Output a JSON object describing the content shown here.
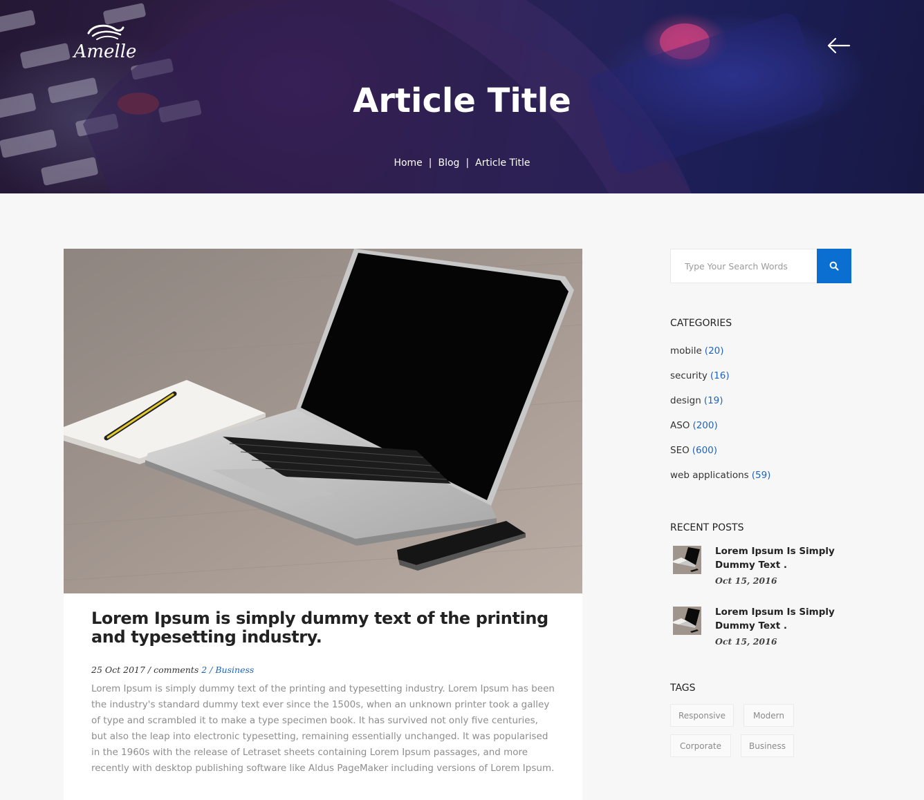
{
  "header": {
    "logo_text": "Amelle",
    "title": "Article Title",
    "breadcrumb": {
      "home": "Home",
      "blog": "Blog",
      "current": "Article Title",
      "separator": "|"
    }
  },
  "article": {
    "title": "Lorem Ipsum is simply dummy text of the printing and typesetting industry.",
    "meta": {
      "date": "25 Oct 2017",
      "comments_label": "comments",
      "comments_count": "2",
      "slash": "/",
      "category": "Business"
    },
    "excerpt": "Lorem Ipsum is simply dummy text of the printing and typesetting industry. Lorem Ipsum has been the industry's standard dummy text ever since the 1500s, when an unknown printer took a galley of type and scrambled it to make a type specimen book. It has survived not only five centuries, but also the leap into electronic typesetting, remaining essentially unchanged. It was popularised in the 1960s with the release of Letraset sheets containing Lorem Ipsum passages, and more recently with desktop publishing software like Aldus PageMaker including versions of Lorem Ipsum."
  },
  "sidebar": {
    "search": {
      "placeholder": "Type Your Search Words",
      "icon": "search-icon"
    },
    "categories": {
      "title": "CATEGORIES",
      "items": [
        {
          "label": "mobile",
          "count": "(20)"
        },
        {
          "label": "security",
          "count": "(16)"
        },
        {
          "label": "design",
          "count": "(19)"
        },
        {
          "label": "ASO",
          "count": "(200)"
        },
        {
          "label": "SEO",
          "count": "(600)"
        },
        {
          "label": "web applications",
          "count": "(59)"
        }
      ]
    },
    "recent_posts": {
      "title": "RECENT POSTS",
      "items": [
        {
          "title": "Lorem Ipsum Is Simply Dummy Text .",
          "date": "Oct 15, 2016"
        },
        {
          "title": "Lorem Ipsum Is Simply Dummy Text .",
          "date": "Oct 15, 2016"
        }
      ]
    },
    "tags": {
      "title": "TAGS",
      "items": [
        "Responsive",
        "Modern",
        "Corporate",
        "Business"
      ]
    }
  },
  "colors": {
    "accent": "#0b6fd1",
    "link": "#1e63b8",
    "background": "#f7f7f7"
  }
}
